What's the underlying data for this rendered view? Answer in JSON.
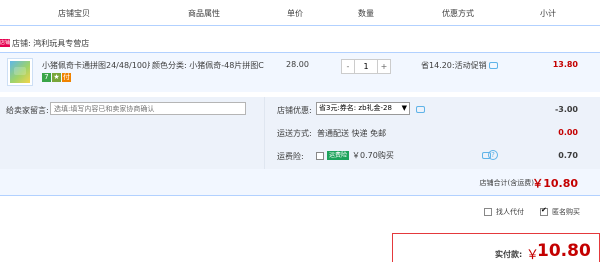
{
  "header": {
    "col_shop_item": "店铺宝贝",
    "col_attr": "商品属性",
    "col_price": "单价",
    "col_qty": "数量",
    "col_promo": "优惠方式",
    "col_subtotal": "小计"
  },
  "shop": {
    "badge": "店铺",
    "name": "店铺: 鸿利玩具专营店"
  },
  "item": {
    "title": "小猪佩奇卡通拼图24/48/100片...",
    "icons": [
      "7",
      "★",
      "付"
    ],
    "attr": "颜色分类: 小猪佩奇-48片拼图C",
    "price": "28.00",
    "qty_minus": "-",
    "qty_value": "1",
    "qty_plus": "+",
    "promo": "省14.20:活动促销",
    "subtotal": "13.80"
  },
  "options": {
    "message_label": "给卖家留言:",
    "message_placeholder": "选填:填写内容已和卖家协商确认",
    "coupon_label": "店铺优惠:",
    "coupon_value": "省3元:券名: zb礼金-28",
    "coupon_amount": "-3.00",
    "shipping_label": "运送方式:",
    "shipping_text": "普通配送 快递 免邮",
    "shipping_amount": "0.00",
    "insurance_label": "运费险:",
    "insurance_badge": "运费险",
    "insurance_text": "￥0.70购买",
    "insurance_amount": "0.70",
    "help": "?"
  },
  "shop_total": {
    "label": "店铺合计(含运费)",
    "value": "￥10.80"
  },
  "agent": {
    "agent_pay": "找人代付",
    "anonymous": "匿名购买"
  },
  "payment": {
    "label": "实付款:",
    "currency": "￥",
    "value": "10.80"
  },
  "colors": {
    "accent_red": "#c40000",
    "border_blue": "#b2d1ff",
    "row_bg": "#f2f7ff"
  }
}
